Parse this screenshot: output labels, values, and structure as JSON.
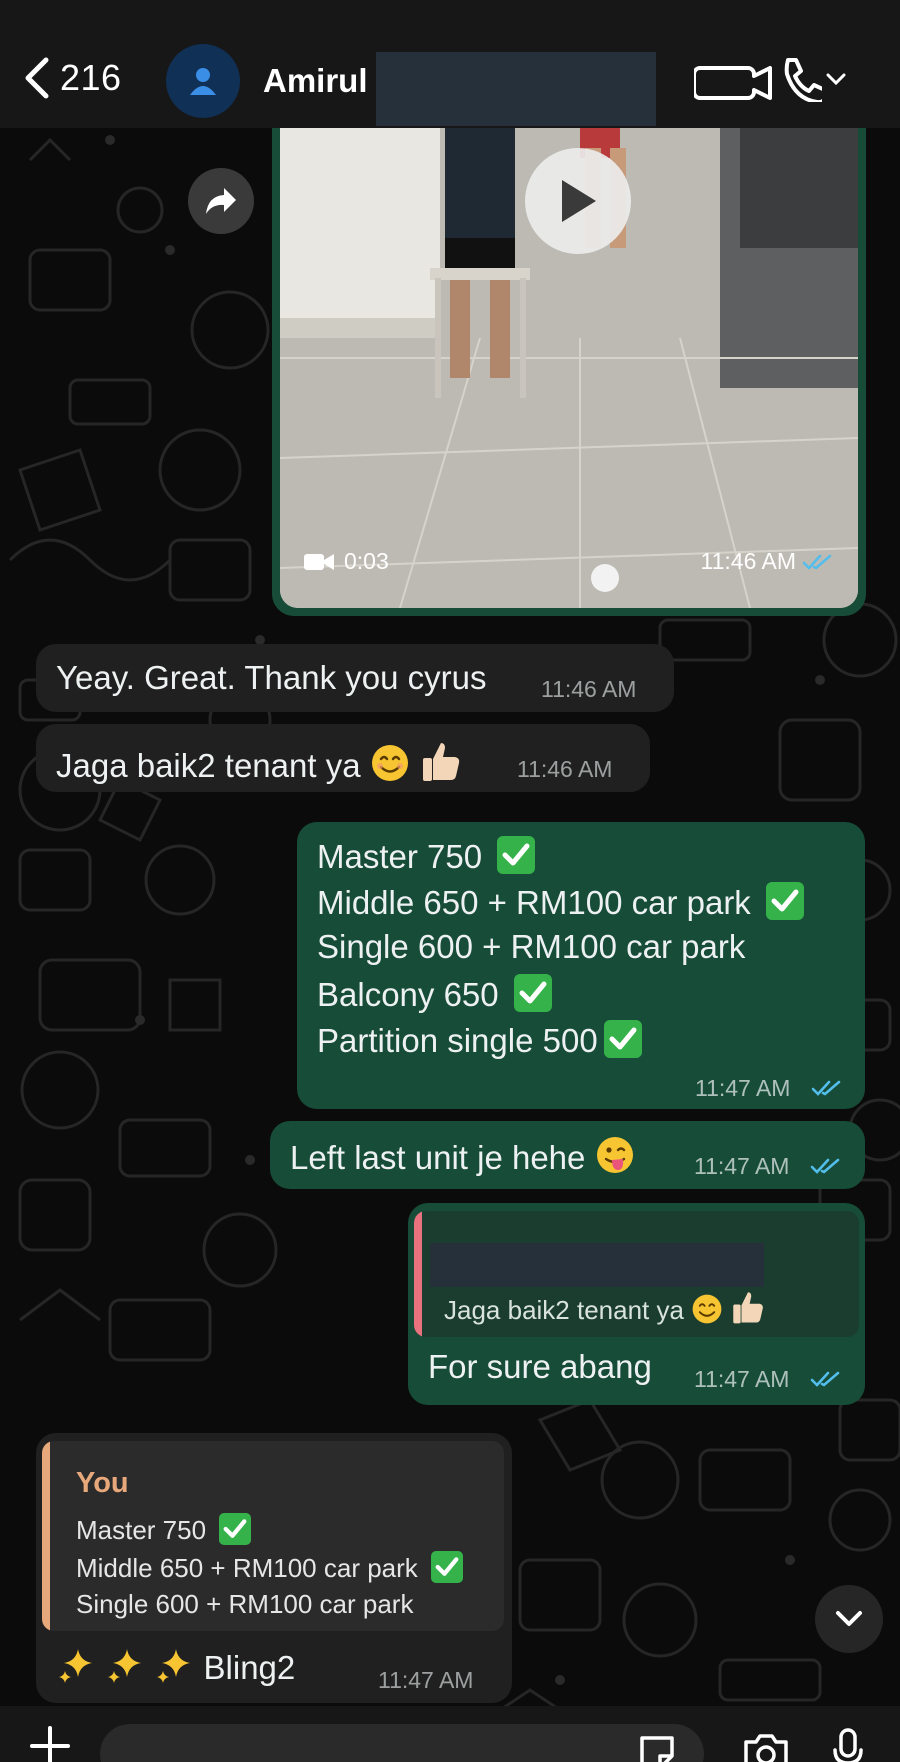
{
  "header": {
    "back_count": "216",
    "contact_name": "Amirul"
  },
  "video_message": {
    "duration": "0:03",
    "time": "11:46 AM"
  },
  "messages": [
    {
      "text": "Yeay. Great. Thank you cyrus",
      "time": "11:46 AM"
    },
    {
      "text": "Jaga baik2 tenant ya",
      "time": "11:46 AM"
    },
    {
      "lines": [
        "Master 750",
        "Middle 650 + RM100 car park",
        "Single 600 + RM100 car park",
        "Balcony 650",
        "Partition single 500"
      ],
      "time": "11:47 AM"
    },
    {
      "text": "Left last unit je hehe",
      "time": "11:47 AM"
    },
    {
      "quote": "Jaga baik2 tenant ya",
      "text": "For sure abang",
      "time": "11:47 AM"
    },
    {
      "quote_author": "You",
      "quote_lines": [
        "Master 750",
        "Middle 650 + RM100 car park",
        "Single 600 + RM100 car park"
      ],
      "text": "Bling2",
      "time": "11:47 AM"
    }
  ],
  "colors": {
    "incoming_bubble": "#202020",
    "outgoing_bubble": "#164c38",
    "read_ticks": "#53bdeb",
    "quote_you_accent": "#e7a87b",
    "quote_other_accent": "#e9727f"
  }
}
